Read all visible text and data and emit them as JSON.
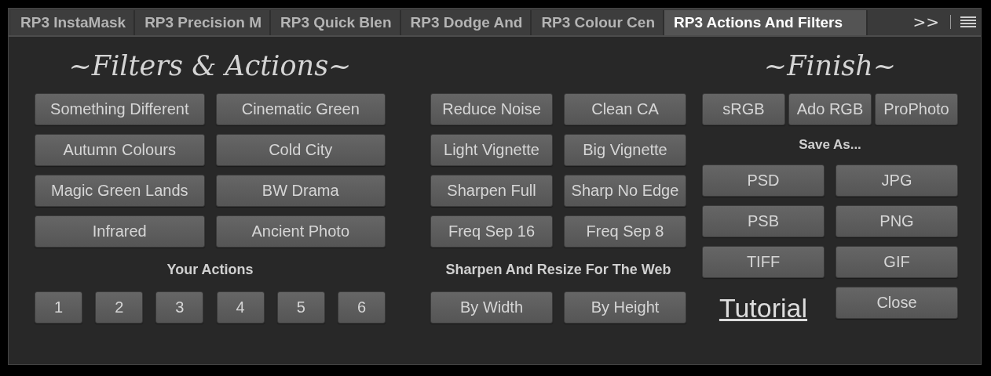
{
  "tabs": [
    {
      "label": "RP3 InstaMask",
      "selected": false
    },
    {
      "label": "RP3 Precision M",
      "selected": false
    },
    {
      "label": "RP3 Quick Blen",
      "selected": false
    },
    {
      "label": "RP3 Dodge And",
      "selected": false
    },
    {
      "label": "RP3 Colour Cen",
      "selected": false
    },
    {
      "label": "RP3 Actions And Filters",
      "selected": true
    }
  ],
  "overflow_button": ">>",
  "left": {
    "title": "~Filters & Actions~",
    "filters": [
      "Something Different",
      "Cinematic Green",
      "Autumn Colours",
      "Cold City",
      "Magic Green Lands",
      "BW Drama",
      "Infrared",
      "Ancient Photo"
    ],
    "actions_heading": "Your Actions",
    "actions": [
      "1",
      "2",
      "3",
      "4",
      "5",
      "6"
    ]
  },
  "middle": {
    "buttons": [
      "Reduce Noise",
      "Clean CA",
      "Light Vignette",
      "Big Vignette",
      "Sharpen Full",
      "Sharp No Edge",
      "Freq Sep 16",
      "Freq Sep 8"
    ],
    "web_heading": "Sharpen And Resize For The Web",
    "web_buttons": [
      "By Width",
      "By Height"
    ]
  },
  "right": {
    "title": "~Finish~",
    "color_spaces": [
      "sRGB",
      "Ado RGB",
      "ProPhoto"
    ],
    "save_heading": "Save As...",
    "formats": [
      "PSD",
      "JPG",
      "PSB",
      "PNG",
      "TIFF",
      "GIF"
    ],
    "tutorial_link": "Tutorial",
    "close_button": "Close"
  }
}
